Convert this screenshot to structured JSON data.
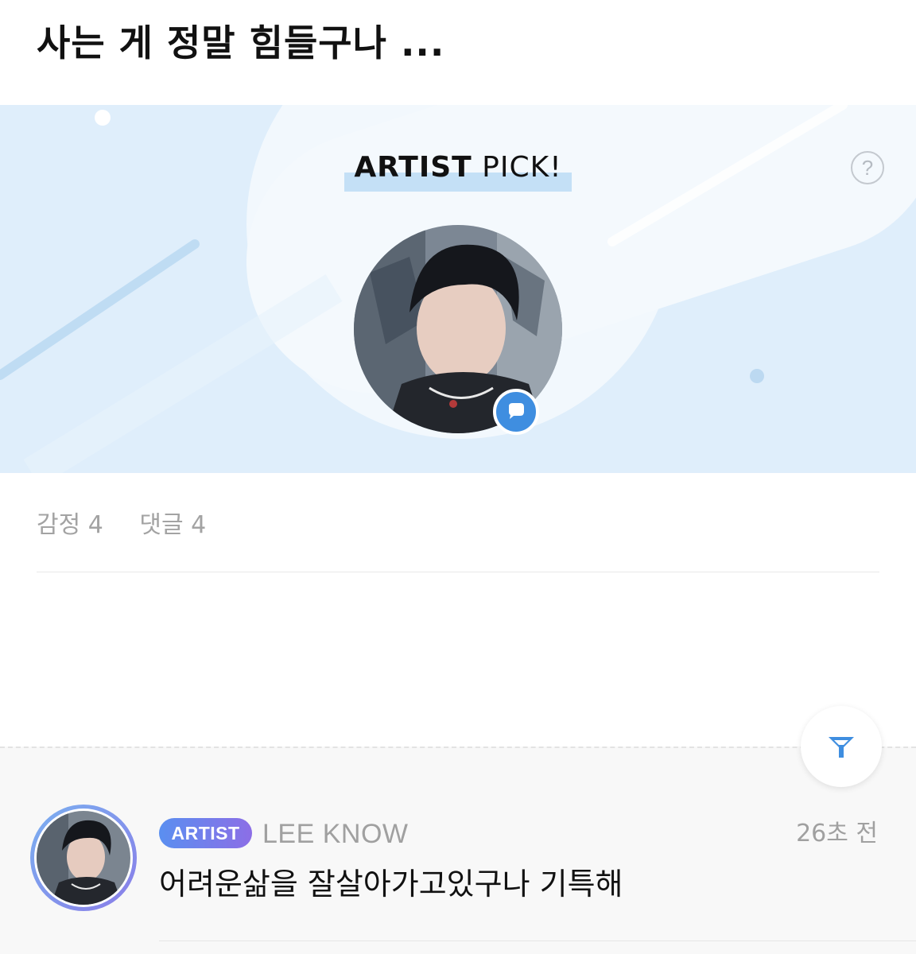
{
  "post": {
    "title": "사는 게 정말 힘들구나 ..."
  },
  "banner": {
    "pick_strong": "ARTIST",
    "pick_rest": " PICK!",
    "help_label": "?",
    "help_icon": "question-icon",
    "badge_icon": "chat-bubble-icon"
  },
  "stats": {
    "emotion_label": "감정 4",
    "comment_label": "댓글 4"
  },
  "filter": {
    "icon": "filter-icon",
    "accent": "#3f8ee0"
  },
  "comment": {
    "badge": "ARTIST",
    "author": "LEE KNOW",
    "time": "26초 전",
    "text": "어려운삶을 잘살아가고있구나 기특해"
  },
  "colors": {
    "banner_bg": "#dfeefb",
    "accent_blue": "#3f8ee0",
    "badge_gradient_start": "#5a8ff0",
    "badge_gradient_end": "#8c6ee6"
  }
}
